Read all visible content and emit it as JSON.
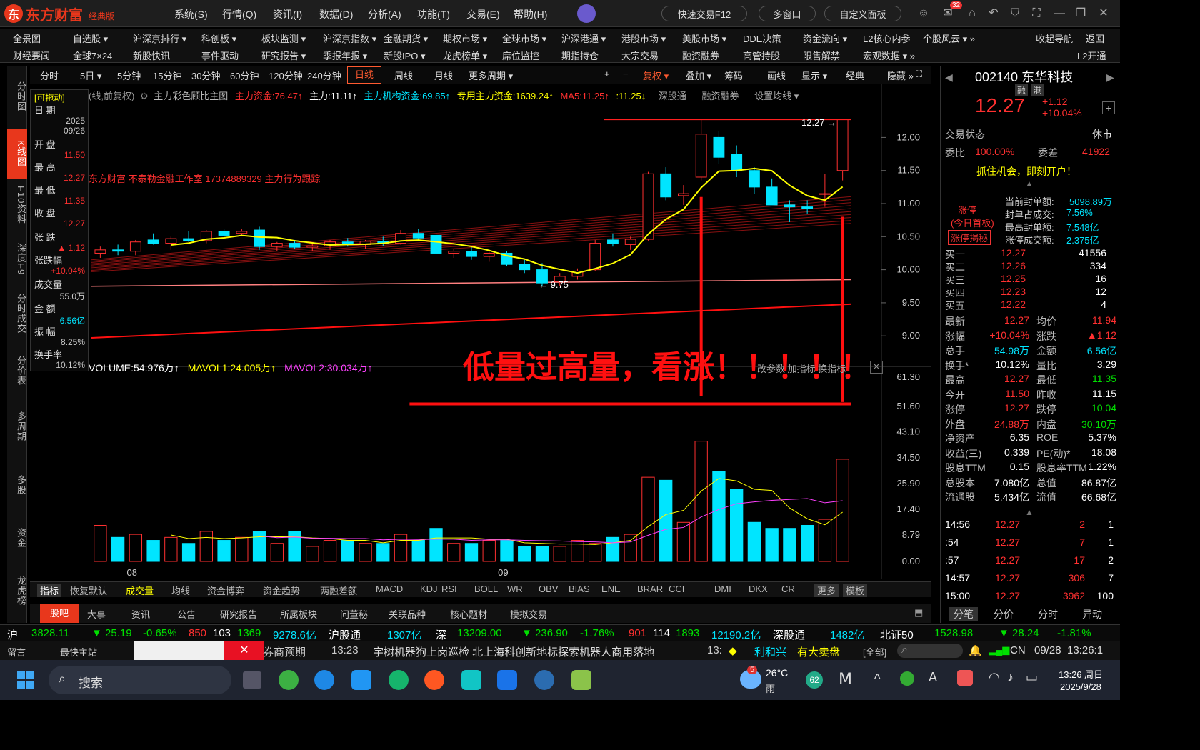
{
  "app": {
    "logo_text": "东方财富",
    "edition": "经典版"
  },
  "menu": [
    "系统(S)",
    "行情(Q)",
    "资讯(I)",
    "数据(D)",
    "分析(A)",
    "功能(T)",
    "交易(E)",
    "帮助(H)"
  ],
  "title_buttons": {
    "quick_trade": "快速交易F12",
    "multi_window": "多窗口",
    "custom_panel": "自定义面板",
    "mail_badge": "32"
  },
  "nav1": [
    "全景图",
    "自选股 ▾",
    "沪深京排行 ▾",
    "科创板 ▾",
    "板块监测 ▾",
    "沪深京指数 ▾",
    "金融期货 ▾",
    "期权市场 ▾",
    "全球市场 ▾",
    "沪深港通 ▾",
    "港股市场 ▾",
    "美股市场 ▾",
    "DDE决策",
    "资金流向 ▾",
    "L2核心内参",
    "个股风云 ▾ »",
    "收起导航",
    "返回"
  ],
  "nav2": [
    "财经要闻",
    "全球7×24",
    "新股快讯",
    "事件驱动",
    "研究报告 ▾",
    "季报年报 ▾",
    "新股IPO ▾",
    "龙虎榜单 ▾",
    "席位监控",
    "期指持仓",
    "大宗交易",
    "融资融券",
    "高管持股",
    "限售解禁",
    "宏观数据 ▾ »",
    "L2开通"
  ],
  "left_sidebar": [
    "分时图",
    "K线图",
    "F10资料",
    "深度F9",
    "分时成交",
    "分价表",
    "多周期",
    "多股",
    "资金",
    "龙虎榜"
  ],
  "periods": [
    "分时",
    "5日 ▾",
    "5分钟",
    "15分钟",
    "30分钟",
    "60分钟",
    "120分钟",
    "240分钟",
    "日线",
    "周线",
    "月线",
    "更多周期 ▾"
  ],
  "period_right": [
    "+",
    "−",
    "复权 ▾",
    "叠加 ▾",
    "筹码",
    "画线",
    "显示 ▾",
    "经典",
    "隐藏 »"
  ],
  "main_indicators": {
    "label": "(线,前复权)",
    "theme": "主力彩色顾比主图",
    "zlzj": "主力资金:76.47↑",
    "zl": "主力:11.11↑",
    "jg": "主力机构资金:69.85↑",
    "zy": "专用主力资金:1639.24↑",
    "ma5": "MA5:11.25↑",
    "v1125": ":11.25↓",
    "sg": "深股通",
    "rz": "融资融券",
    "sz": "设置均线 ▾"
  },
  "watermark": "东方财富 不泰勒金融工作室 17374889329 主力行为跟踪",
  "annotation": "低量过高量，看涨！！！！！",
  "price_marks": {
    "high": "12.27 →",
    "low": "← 9.75"
  },
  "infobox": {
    "drag": "[可拖动]",
    "rows": [
      [
        "日 期",
        "2025\n09/26"
      ],
      [
        "开 盘",
        "11.50"
      ],
      [
        "最 高",
        "12.27"
      ],
      [
        "最 低",
        "11.35"
      ],
      [
        "收 盘",
        "12.27"
      ],
      [
        "张 跌",
        "▲ 1.12"
      ],
      [
        "张跌幅",
        "+10.04%"
      ],
      [
        "成交量",
        "55.0万"
      ],
      [
        "金 额",
        "6.56亿"
      ],
      [
        "振 幅",
        "8.25%"
      ],
      [
        "换手率",
        "10.12%"
      ]
    ]
  },
  "volume_header": {
    "vol": "VOLUME:54.976万↑",
    "m1": "MAVOL1:24.005万↑",
    "m2": "MAVOL2:30.034万↑",
    "right": "改参数 加指标 换指标"
  },
  "price_axis": [
    "12.00",
    "11.50",
    "11.00",
    "10.50",
    "10.00",
    "9.50",
    "9.00"
  ],
  "vol_axis": [
    "61.30",
    "51.60",
    "43.10",
    "34.50",
    "25.90",
    "17.40",
    "8.79",
    "0.00"
  ],
  "date_axis": [
    "08",
    "09"
  ],
  "chart_data": {
    "type": "candlestick",
    "ylim": [
      8.7,
      12.35
    ],
    "candles": [
      {
        "o": 10.25,
        "h": 10.35,
        "l": 10.18,
        "c": 10.3
      },
      {
        "o": 10.3,
        "h": 10.38,
        "l": 10.22,
        "c": 10.28
      },
      {
        "o": 10.28,
        "h": 10.45,
        "l": 10.22,
        "c": 10.42
      },
      {
        "o": 10.45,
        "h": 10.55,
        "l": 10.38,
        "c": 10.4
      },
      {
        "o": 10.4,
        "h": 10.5,
        "l": 10.3,
        "c": 10.47
      },
      {
        "o": 10.47,
        "h": 10.58,
        "l": 10.42,
        "c": 10.44
      },
      {
        "o": 10.44,
        "h": 10.6,
        "l": 10.4,
        "c": 10.58
      },
      {
        "o": 10.58,
        "h": 10.62,
        "l": 10.5,
        "c": 10.52
      },
      {
        "o": 10.55,
        "h": 10.62,
        "l": 10.52,
        "c": 10.58
      },
      {
        "o": 10.6,
        "h": 10.65,
        "l": 10.3,
        "c": 10.35
      },
      {
        "o": 10.35,
        "h": 10.42,
        "l": 10.28,
        "c": 10.4
      },
      {
        "o": 10.4,
        "h": 10.45,
        "l": 10.32,
        "c": 10.34
      },
      {
        "o": 10.34,
        "h": 10.4,
        "l": 10.28,
        "c": 10.36
      },
      {
        "o": 10.36,
        "h": 10.45,
        "l": 10.3,
        "c": 10.42
      },
      {
        "o": 10.42,
        "h": 10.48,
        "l": 10.35,
        "c": 10.38
      },
      {
        "o": 10.38,
        "h": 10.45,
        "l": 10.32,
        "c": 10.43
      },
      {
        "o": 10.43,
        "h": 10.5,
        "l": 10.36,
        "c": 10.4
      },
      {
        "o": 10.4,
        "h": 10.6,
        "l": 10.38,
        "c": 10.55
      },
      {
        "o": 10.55,
        "h": 10.62,
        "l": 10.45,
        "c": 10.48
      },
      {
        "o": 10.52,
        "h": 10.58,
        "l": 10.2,
        "c": 10.25
      },
      {
        "o": 10.25,
        "h": 10.32,
        "l": 10.18,
        "c": 10.28
      },
      {
        "o": 10.28,
        "h": 10.34,
        "l": 10.15,
        "c": 10.2
      },
      {
        "o": 10.2,
        "h": 10.3,
        "l": 10.12,
        "c": 10.25
      },
      {
        "o": 10.25,
        "h": 10.28,
        "l": 10.05,
        "c": 10.08
      },
      {
        "o": 10.08,
        "h": 10.15,
        "l": 9.95,
        "c": 10.0
      },
      {
        "o": 10.0,
        "h": 10.1,
        "l": 9.75,
        "c": 9.8
      },
      {
        "o": 9.82,
        "h": 9.95,
        "l": 9.75,
        "c": 9.9
      },
      {
        "o": 9.9,
        "h": 10.02,
        "l": 9.85,
        "c": 9.98
      },
      {
        "o": 10.0,
        "h": 10.45,
        "l": 9.98,
        "c": 10.4
      },
      {
        "o": 10.45,
        "h": 10.55,
        "l": 10.35,
        "c": 10.4
      },
      {
        "o": 10.38,
        "h": 10.5,
        "l": 10.3,
        "c": 10.46
      },
      {
        "o": 10.46,
        "h": 11.48,
        "l": 10.44,
        "c": 11.45
      },
      {
        "o": 11.45,
        "h": 11.55,
        "l": 11.05,
        "c": 11.1
      },
      {
        "o": 11.12,
        "h": 11.28,
        "l": 10.98,
        "c": 11.15
      },
      {
        "o": 11.4,
        "h": 12.27,
        "l": 11.35,
        "c": 12.05
      },
      {
        "o": 12.0,
        "h": 12.1,
        "l": 11.6,
        "c": 11.7
      },
      {
        "o": 11.75,
        "h": 11.88,
        "l": 11.4,
        "c": 11.5
      },
      {
        "o": 11.5,
        "h": 11.55,
        "l": 11.15,
        "c": 11.25
      },
      {
        "o": 11.25,
        "h": 11.38,
        "l": 10.98,
        "c": 10.98
      },
      {
        "o": 10.98,
        "h": 11.05,
        "l": 10.72,
        "c": 10.95
      },
      {
        "o": 10.95,
        "h": 11.05,
        "l": 10.85,
        "c": 10.92
      },
      {
        "o": 11.15,
        "h": 11.45,
        "l": 10.95,
        "c": 11.15
      },
      {
        "o": 11.5,
        "h": 12.27,
        "l": 11.35,
        "c": 12.27
      }
    ],
    "volumes": [
      12,
      8,
      9,
      7,
      8,
      6,
      10,
      7,
      8,
      10,
      6,
      10,
      5,
      7,
      7,
      6,
      6,
      9,
      7,
      11,
      6,
      6,
      7,
      7,
      5,
      5,
      5,
      7,
      6,
      8,
      9,
      28,
      27,
      13,
      40,
      30,
      24,
      13,
      11,
      11,
      12,
      14,
      34
    ]
  },
  "right": {
    "code": "002140",
    "name": "东华科技",
    "tags": [
      "融",
      "港"
    ],
    "price": "12.27",
    "chg": "+1.12",
    "pct": "+10.04%",
    "status_label": "交易状态",
    "status": "休市",
    "wb_label": "委比",
    "wb": "100.00%",
    "wc_label": "委差",
    "wc": "41922",
    "promo": "抓住机会，即刻开户！",
    "limit_tag": [
      "涨停",
      "(今日首板)",
      "涨停揭秘"
    ],
    "limit_info": [
      [
        "当前封单额:",
        "5098.89万"
      ],
      [
        "封单占成交:",
        "7.56%"
      ],
      [
        "最高封单额:",
        "7.548亿"
      ],
      [
        "涨停成交额:",
        "2.375亿"
      ]
    ],
    "bids": [
      [
        "买一",
        "12.27",
        "41556"
      ],
      [
        "买二",
        "12.26",
        "334"
      ],
      [
        "买三",
        "12.25",
        "16"
      ],
      [
        "买四",
        "12.23",
        "12"
      ],
      [
        "买五",
        "12.22",
        "4"
      ]
    ],
    "stats": [
      [
        "最新",
        "12.27",
        "均价",
        "11.94"
      ],
      [
        "涨幅",
        "+10.04%",
        "涨跌",
        "▲1.12"
      ],
      [
        "总手",
        "54.98万",
        "金额",
        "6.56亿"
      ],
      [
        "换手*",
        "10.12%",
        "量比",
        "3.29"
      ],
      [
        "最高",
        "12.27",
        "最低",
        "11.35"
      ],
      [
        "今开",
        "11.50",
        "昨收",
        "11.15"
      ],
      [
        "涨停",
        "12.27",
        "跌停",
        "10.04"
      ],
      [
        "外盘",
        "24.88万",
        "内盘",
        "30.10万"
      ],
      [
        "净资产",
        "6.35",
        "ROE",
        "5.37%"
      ],
      [
        "收益(三)",
        "0.339",
        "PE(动)*",
        "18.08"
      ],
      [
        "股息TTM",
        "0.15",
        "股息率TTM",
        "1.22%"
      ],
      [
        "总股本",
        "7.080亿",
        "总值",
        "86.87亿"
      ],
      [
        "流通股",
        "5.434亿",
        "流值",
        "66.68亿"
      ]
    ],
    "trades": [
      [
        "14:56",
        "12.27",
        "2",
        "1"
      ],
      [
        ":54",
        "12.27",
        "7",
        "1"
      ],
      [
        ":57",
        "12.27",
        "17",
        "2"
      ],
      [
        "14:57",
        "12.27",
        "306",
        "7"
      ],
      [
        "15:00",
        "12.27",
        "3962",
        "100"
      ]
    ],
    "tabs": [
      "分笔",
      "分价",
      "分时",
      "异动"
    ]
  },
  "indicator_tabs": [
    "指标",
    "恢复默认",
    "成交量",
    "均线",
    "资金博弈",
    "资金趋势",
    "两融差额",
    "MACD",
    "KDJ",
    "RSI",
    "BOLL",
    "WR",
    "OBV",
    "BIAS",
    "ENE",
    "BRAR",
    "CCI",
    "DMI",
    "DKX",
    "CR",
    "更多",
    "模板"
  ],
  "bottom_tabs": [
    "股吧",
    "大事",
    "资讯",
    "公告",
    "研究报告",
    "所属板块",
    "问董秘",
    "关联品种",
    "核心题材",
    "模拟交易"
  ],
  "ticker": {
    "sh": "沪",
    "sh_v": "3828.11",
    "sh_c": "▼ 25.19",
    "sh_p": "-0.65%",
    "sh_a": "850",
    "sh_b": "103",
    "sh_d": "1369",
    "sh_amt": "9278.6亿",
    "hgt": "沪股通",
    "hgt_v": "1307亿",
    "sz": "深",
    "sz_v": "13209.00",
    "sz_c": "▼ 236.90",
    "sz_p": "-1.76%",
    "sz_a": "901",
    "sz_b": "114",
    "sz_d": "1893",
    "sz_amt": "12190.2亿",
    "sgt": "深股通",
    "sgt_v": "1482亿",
    "bz": "北证50",
    "bz_v": "1528.98",
    "bz_c": "▼ 28.24",
    "bz_p": "-1.81%"
  },
  "news": {
    "msg": "留言",
    "home": "最快主站",
    "t": "13:23",
    "text": "宇树机器狗上岗巡检 北上海科创新地标探索机器人商用落地",
    "prev": "券商预期",
    "t2": "13:",
    "stock": "利和兴",
    "event": "有大卖盘",
    "all": "[全部]",
    "cn": "CN",
    "date": "09/28",
    "time": "13:26:1"
  },
  "taskbar": {
    "search": "搜索",
    "weather_t": "26°C",
    "weather": "雨",
    "badge": "5",
    "num": "62",
    "time": "13:26 周日",
    "date": "2025/9/28",
    "A": "A"
  }
}
